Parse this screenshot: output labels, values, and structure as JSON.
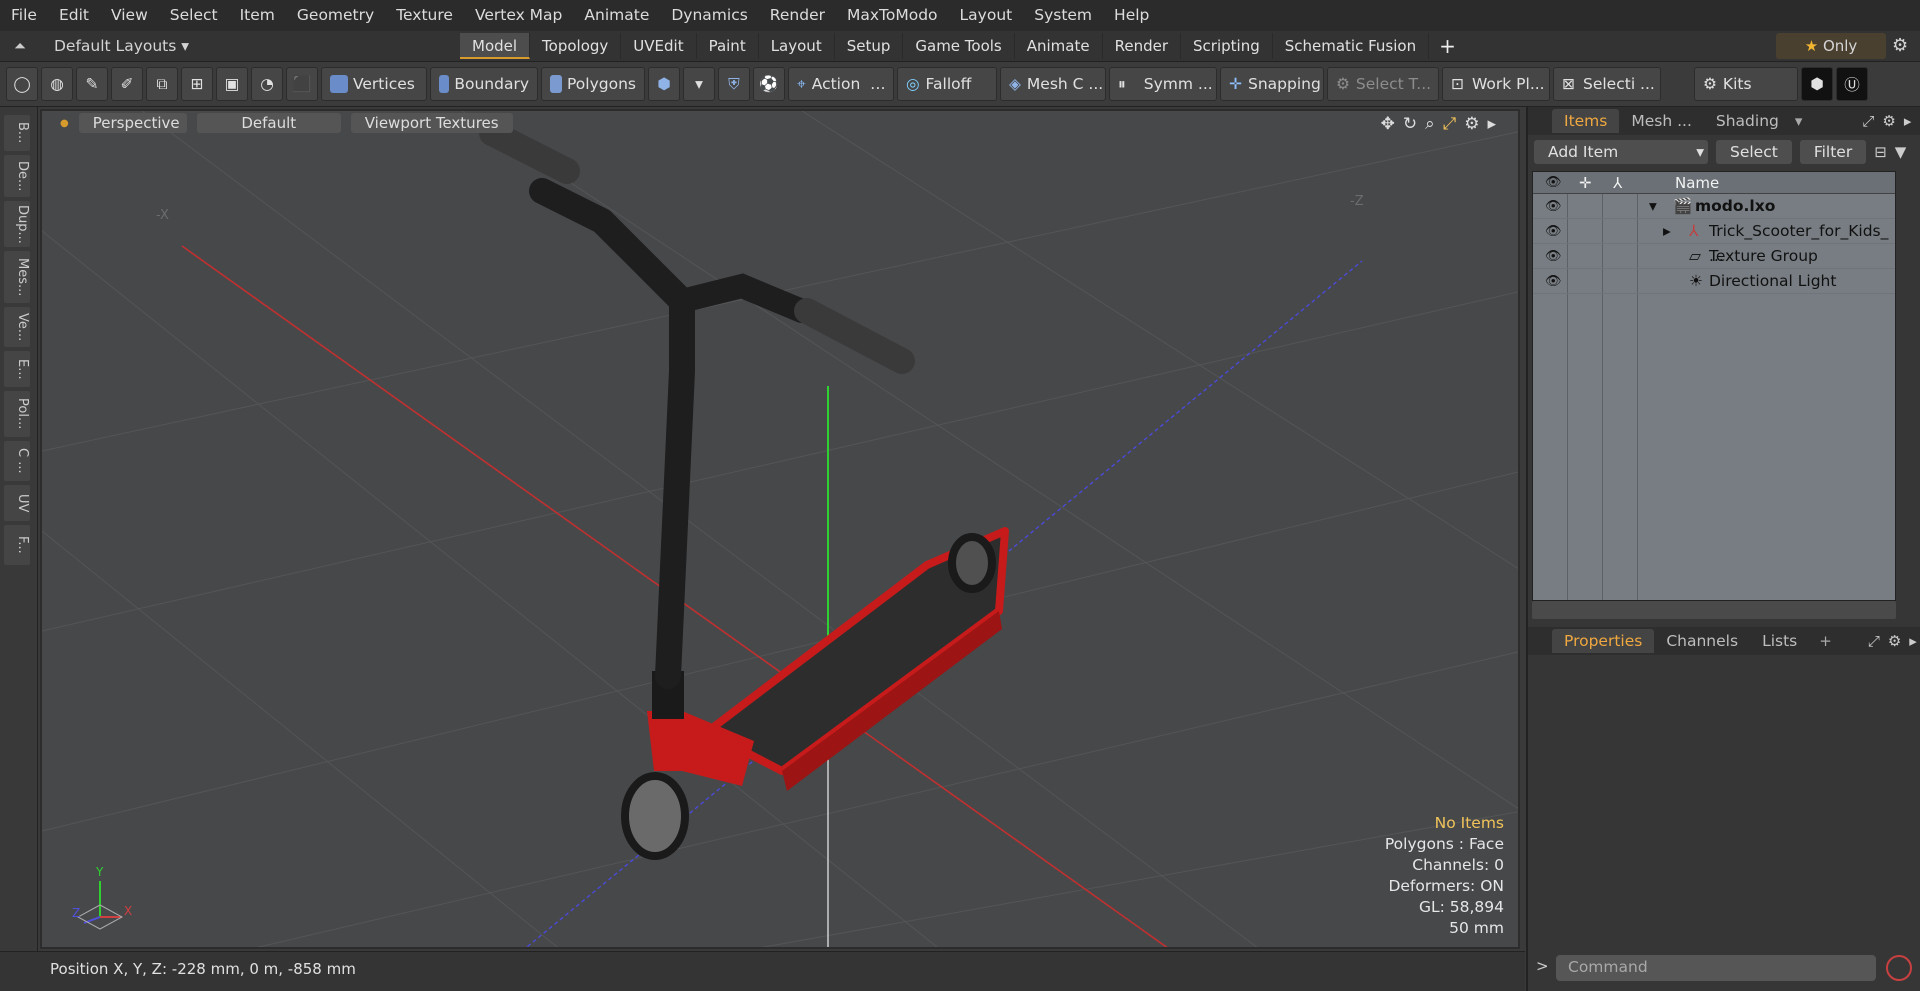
{
  "menu": [
    "File",
    "Edit",
    "View",
    "Select",
    "Item",
    "Geometry",
    "Texture",
    "Vertex Map",
    "Animate",
    "Dynamics",
    "Render",
    "MaxToModo",
    "Layout",
    "System",
    "Help"
  ],
  "layout_selector": "Default Layouts",
  "layout_tabs": [
    "Model",
    "Topology",
    "UVEdit",
    "Paint",
    "Layout",
    "Setup",
    "Game Tools",
    "Animate",
    "Render",
    "Scripting",
    "Schematic Fusion"
  ],
  "active_layout_tab": "Model",
  "only_label": "Only",
  "toolbar": {
    "vertices": "Vertices",
    "boundary": "Boundary",
    "polygons": "Polygons",
    "action": "Action",
    "falloff": "Falloff",
    "mesh": "Mesh C ...",
    "symm": "Symm ...",
    "snapping": "Snapping",
    "select_t": "Select T...",
    "work_pl": "Work Pl...",
    "selecti": "Selecti ...",
    "kits": "Kits"
  },
  "left_tabs": [
    "B...",
    "De...",
    "Dup...",
    "Mes...",
    "Ve...",
    "E...",
    "Pol...",
    "C ...",
    "UV",
    "F..."
  ],
  "viewport": {
    "perspective": "Perspective",
    "default": "Default",
    "textures": "Viewport Textures",
    "axis_x": "-X",
    "axis_z": "-Z",
    "gizmo_y": "Y",
    "gizmo_x": "X",
    "gizmo_z": "Z",
    "stats": {
      "no_items": "No Items",
      "polygons": "Polygons : Face",
      "channels": "Channels: 0",
      "deformers": "Deformers: ON",
      "gl": "GL: 58,894",
      "size": "50 mm"
    }
  },
  "status": "Position X, Y, Z:   -228 mm, 0 m, -858 mm",
  "items_panel": {
    "tabs": [
      "Items",
      "Mesh ...",
      "Shading"
    ],
    "add_item": "Add Item",
    "select": "Select",
    "filter": "Filter",
    "name_header": "Name",
    "rows": [
      "modo.lxo",
      "Trick_Scooter_for_Kids_ ...",
      "Texture Group",
      "Directional Light"
    ]
  },
  "properties_panel": {
    "tabs": [
      "Properties",
      "Channels",
      "Lists"
    ]
  },
  "command_placeholder": "Command",
  "colors": {
    "accent": "#d69a2d",
    "deck_red": "#c71b1b",
    "x_axis": "#c03030",
    "y_axis": "#2fd02f",
    "z_axis": "#4040d0"
  }
}
